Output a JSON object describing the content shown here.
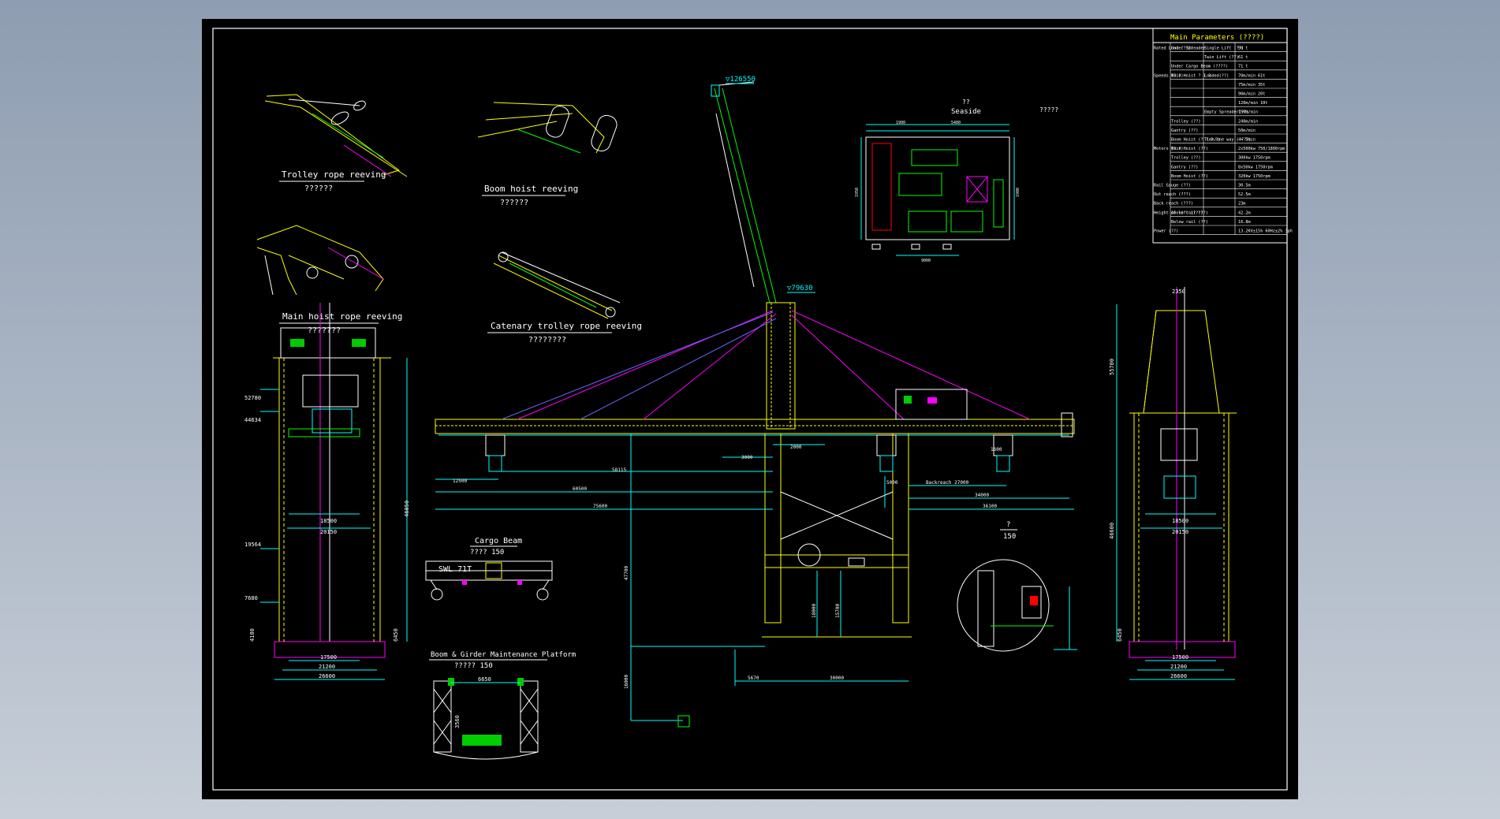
{
  "drawing": {
    "titles": {
      "trolley_reeving": "Trolley rope reeving",
      "trolley_reeving_sub": "??????",
      "boom_reeving": "Boom hoist reeving",
      "boom_reeving_sub": "??????",
      "main_hoist_reeving": "Main hoist rope reeving",
      "main_hoist_reeving_sub": "???????",
      "catenary_reeving": "Catenary trolley rope reeving",
      "catenary_reeving_sub": "????????",
      "cargo_beam": "Cargo Beam",
      "cargo_beam_scale": "????      150",
      "cargo_beam_swl": "SWL 71T",
      "platform": "Boom & Girder Maintenance Platform",
      "platform_scale": "?????      150",
      "detail_label": "?",
      "detail_scale": "150",
      "seaside": "Seaside",
      "seaside_mark": "??",
      "cabin_note": "?????"
    },
    "elevations": {
      "top": "▽126550",
      "apex": "▽79630"
    },
    "dims_side": [
      "52780",
      "44634",
      "19564",
      "7680"
    ],
    "dims_main": {
      "d1": "12500",
      "d2": "60500",
      "d3": "58115",
      "d4": "75600",
      "d5": "3000",
      "d6": "2000",
      "d7": "Backreach 27000",
      "d8": "34000",
      "d9": "36100",
      "d10": "5000",
      "d11": "47700",
      "d12": "18000",
      "d13": "15700",
      "d14": "16000",
      "d15": "5670",
      "d16": "30000",
      "d17": "1600"
    },
    "dims_left_view": [
      "18500",
      "20150",
      "46050",
      "17500",
      "21200",
      "26600",
      "6450",
      "4100"
    ],
    "dims_right_view": [
      "55700",
      "46600",
      "18500",
      "20150",
      "17500",
      "21200",
      "26600",
      "6450",
      "2350"
    ],
    "dims_cabin": [
      "1900",
      "5400",
      "9000",
      "1950",
      "1900"
    ],
    "dims_platform": [
      "6650",
      "3560"
    ]
  },
  "params": {
    "title": "Main Parameters (????)",
    "rows": [
      {
        "g": "Rated Load (???)",
        "k": "Under Spreader",
        "s": "Single Lift (??)",
        "v": "50 t"
      },
      {
        "g": "",
        "k": "",
        "s": "Twin Lift (??)",
        "v": "61 t"
      },
      {
        "g": "",
        "k": "Under Cargo Beam (????)",
        "s": "",
        "v": "71 t"
      },
      {
        "g": "Speeds (? ?)",
        "k": "Main Hoist ? ? ?",
        "s": "Loaded(??)",
        "v": "70m/min  61t"
      },
      {
        "g": "",
        "k": "",
        "s": "",
        "v": "75m/min  35t"
      },
      {
        "g": "",
        "k": "",
        "s": "",
        "v": "90m/min  20t"
      },
      {
        "g": "",
        "k": "",
        "s": "",
        "v": "120m/min  10t"
      },
      {
        "g": "",
        "k": "",
        "s": "Empty Spreader(??)",
        "v": "150m/min"
      },
      {
        "g": "",
        "k": "Trolley (??)",
        "s": "",
        "v": "240m/min"
      },
      {
        "g": "",
        "k": "Gantry (??)",
        "s": "",
        "v": "50m/min"
      },
      {
        "g": "",
        "k": "Boom Hoist (? ? ? ?)",
        "s": "Time/one way (????)",
        "v": "<= 5min"
      },
      {
        "g": "Motors (? ?)",
        "k": "Main Hoist (??)",
        "s": "",
        "v": "2x500kw 750/1800rpm"
      },
      {
        "g": "",
        "k": "Trolley (??)",
        "s": "",
        "v": "300kw 1750rpm"
      },
      {
        "g": "",
        "k": "Gantry (??)",
        "s": "",
        "v": "8x50kw 1750rpm"
      },
      {
        "g": "",
        "k": "Boom Hoist (??)",
        "s": "",
        "v": "320kw 1750rpm"
      },
      {
        "g": "Rail Gauge (??)",
        "k": "",
        "s": "",
        "v": "30.5m"
      },
      {
        "g": "Out reach (???)",
        "k": "",
        "s": "",
        "v": "52.5m"
      },
      {
        "g": "Back reach (???)",
        "k": "",
        "s": "",
        "v": "23m"
      },
      {
        "g": "Height of lift (???)",
        "k": "Above rail (??)",
        "s": "",
        "v": "42.2m"
      },
      {
        "g": "",
        "k": "Below rail (??)",
        "s": "",
        "v": "16.8m"
      },
      {
        "g": "Power (??)",
        "k": "",
        "s": "",
        "v": "13.2KV±15% 60Hz±2% 3ph"
      }
    ]
  }
}
